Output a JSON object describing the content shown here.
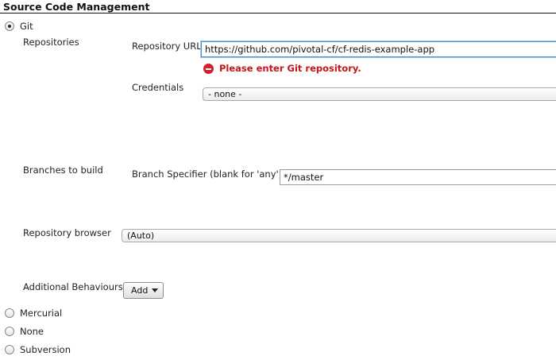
{
  "section": {
    "title": "Source Code Management"
  },
  "scm_options": {
    "git": {
      "label": "Git",
      "checked": true
    },
    "mercurial": {
      "label": "Mercurial",
      "checked": false
    },
    "none": {
      "label": "None",
      "checked": false
    },
    "subversion": {
      "label": "Subversion",
      "checked": false
    }
  },
  "git": {
    "repositories_label": "Repositories",
    "repository_url": {
      "label": "Repository URL",
      "value": "https://github.com/pivotal-cf/cf-redis-example-app",
      "error": "Please enter Git repository."
    },
    "credentials": {
      "label": "Credentials",
      "selected": "- none -"
    },
    "branches_label": "Branches to build",
    "branch_specifier": {
      "label": "Branch Specifier (blank for 'any')",
      "value": "*/master"
    },
    "repository_browser": {
      "label": "Repository browser",
      "selected": "(Auto)"
    },
    "additional_behaviours": {
      "label": "Additional Behaviours",
      "button_label": "Add"
    }
  },
  "icons": {
    "error": "error-circle-icon",
    "dropdown": "caret-down-icon"
  },
  "colors": {
    "error": "#c4161c",
    "focus_border": "#4a8fd0"
  }
}
